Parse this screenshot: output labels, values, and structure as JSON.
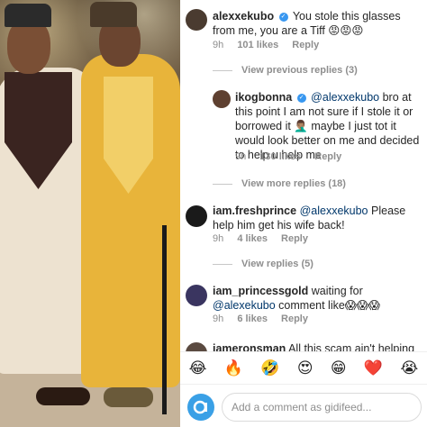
{
  "comments": [
    {
      "username": "alexxekubo",
      "text": "You stole this glasses from me, you are a Tiff 😡😡😡",
      "time": "9h",
      "likes": "101 likes",
      "reply": "Reply",
      "view_replies": "View previous replies (3)"
    },
    {
      "username": "ikogbonna",
      "mention": "@alexxekubo",
      "text": "bro at this point I am not sure if I stole it or borrowed it 🤦🏽‍♂️ maybe I just tot it would look better on me and decided to help u help me",
      "time": "9h",
      "likes": "130 likes",
      "reply": "Reply",
      "view_replies": "View more replies (18)"
    },
    {
      "username": "iam.freshprince",
      "mention": "@alexxekubo",
      "text": "Please help him get his wife back!",
      "time": "9h",
      "likes": "4 likes",
      "reply": "Reply",
      "view_replies": "View replies (5)"
    },
    {
      "username": "iam_princessgold",
      "text_before": "waiting for",
      "mention": "@alexekubo",
      "text_after": "comment like😱😱😱",
      "time": "9h",
      "likes": "6 likes",
      "reply": "Reply"
    },
    {
      "username": "jameronsman",
      "text": "All this scam ain't helping"
    }
  ],
  "emojis": [
    "😂",
    "🔥",
    "🤣",
    "😍",
    "😁",
    "❤️",
    "😭"
  ],
  "input": {
    "placeholder": "Add a comment as gidifeed..."
  },
  "icons": {
    "verified": "verified-badge-icon",
    "account": "gidifeed-avatar-icon"
  },
  "colors": {
    "mention": "#00376b",
    "muted": "#8e8e8e",
    "verified": "#3897f0"
  }
}
